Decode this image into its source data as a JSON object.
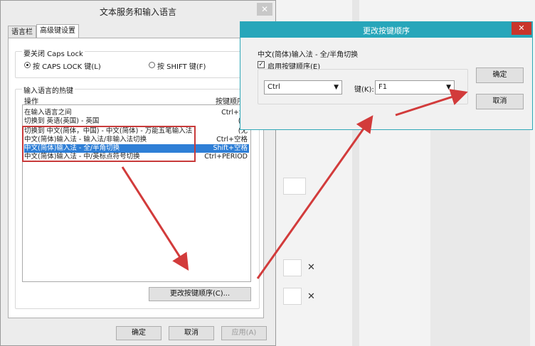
{
  "main_dialog": {
    "title": "文本服务和输入语言",
    "tabs": [
      "语言栏",
      "高级键设置"
    ],
    "caps_lock": {
      "heading": "要关闭 Caps Lock",
      "options": [
        "按 CAPS LOCK 键(L)",
        "按 SHIFT 键(F)"
      ],
      "selected_index": 0
    },
    "hotkeys": {
      "heading": "输入语言的热键",
      "col_action": "操作",
      "col_key": "按键顺序",
      "rows": [
        {
          "action": "在输入语言之间",
          "key": "Ctrl+Sh"
        },
        {
          "action": "切换到 英语(英国) - 英国",
          "key": "(无"
        },
        {
          "action": "切换到 中文(简体，中国) - 中文(简体) - 万能五笔输入法",
          "key": "(无"
        },
        {
          "action": "中文(简体)输入法 - 输入法/非输入法切换",
          "key": "Ctrl+空格"
        },
        {
          "action": "中文(简体)输入法 - 全/半角切换",
          "key": "Shift+空格"
        },
        {
          "action": "中文(简体)输入法 - 中/英标点符号切换",
          "key": "Ctrl+PERIOD"
        }
      ],
      "selected_index": 4
    },
    "change_sequence_button": "更改按键顺序(C)...",
    "ok": "确定",
    "cancel": "取消",
    "apply": "应用(A)",
    "close": "✕"
  },
  "change_dialog": {
    "title": "更改按键顺序",
    "subtitle": "中文(简体)输入法 - 全/半角切换",
    "enable_label": "启用按键顺序(E)",
    "enable_checked": true,
    "modifier_value": "Ctrl",
    "key_label": "键(K):",
    "key_value": "F1",
    "ok": "确定",
    "cancel": "取消",
    "close": "✕"
  },
  "background": {
    "remove_icons": [
      "✕",
      "✕"
    ]
  },
  "colors": {
    "accent_title": "#27a6ba",
    "close_red": "#c9352b",
    "selection": "#2f7fd6",
    "annotation_red": "#d23b3b"
  }
}
